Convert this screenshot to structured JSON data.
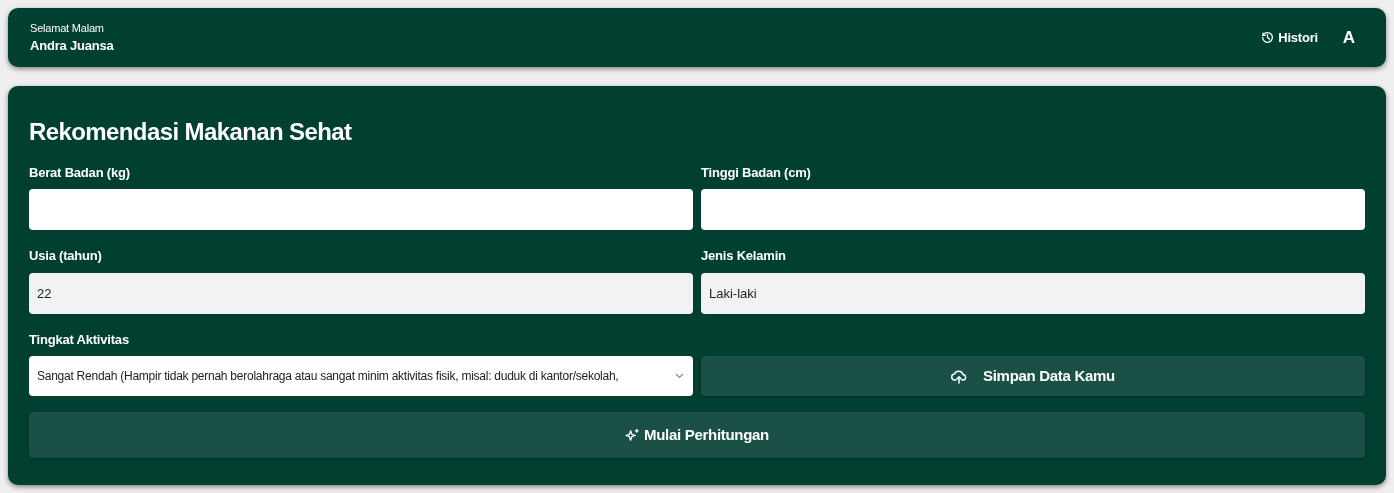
{
  "header": {
    "greeting": "Selamat Malam",
    "user_name": "Andra Juansa",
    "history_button": "Histori",
    "avatar_initial": "A"
  },
  "form": {
    "title": "Rekomendasi Makanan Sehat",
    "fields": [
      {
        "label": "Berat Badan (kg)",
        "disabled": false
      },
      {
        "label": "Tinggi Badan (cm)",
        "disabled": false
      },
      {
        "label": "Usia (tahun)",
        "value": "22",
        "disabled": true
      },
      {
        "label": "Jenis Kelamin",
        "value": "Laki-laki",
        "disabled": true
      }
    ],
    "activity": {
      "label": "Tingkat Aktivitas",
      "value": "Sangat Rendah (Hampir tidak pernah berolahraga atau sangat minim aktivitas fisik, misal: duduk di kantor/sekolah,"
    },
    "save_button": "Simpan Data Kamu",
    "start_button": "Mulai Perhitungan"
  }
}
